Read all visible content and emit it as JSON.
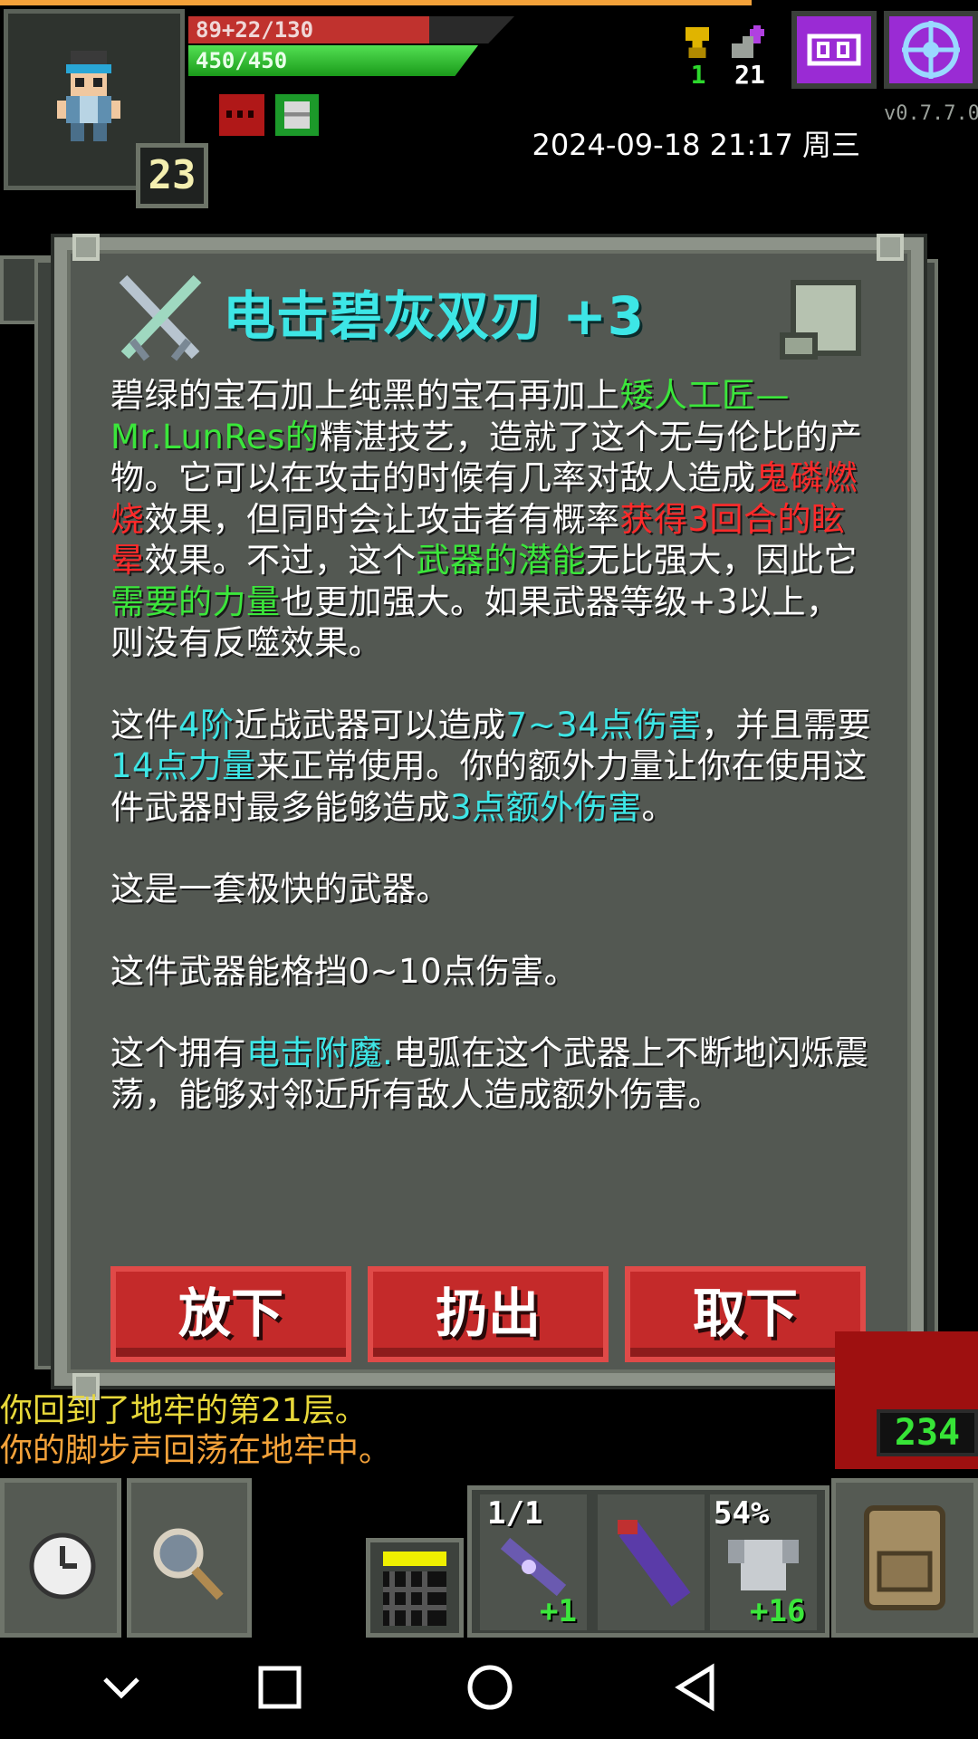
{
  "status": {
    "exp_text": "89+22/130",
    "exp_fraction": 0.74,
    "hp_text": "450/450",
    "hp_fraction": 1.0,
    "level": "23",
    "trophies": "1",
    "depth": "21",
    "version": "v0.7.7.0",
    "datetime": "2024-09-18 21:17 周三"
  },
  "dialog": {
    "title": "电击碧灰双刃 +3",
    "desc_1_a": "碧绿的宝石加上纯黑的宝石再加上",
    "desc_1_b": "矮人工匠—Mr.LunRes的",
    "desc_1_c": "精湛技艺，造就了这个无与伦比的产物。它可以在攻击的时候有几率对敌人造成",
    "desc_1_d": "鬼磷燃烧",
    "desc_1_e": "效果，但同时会让攻击者有概率",
    "desc_1_f": "获得3回合的眩晕",
    "desc_1_g": "效果。不过，这个",
    "desc_1_h": "武器的潜能",
    "desc_1_i": "无比强大，因此它",
    "desc_1_j": "需要的力量",
    "desc_1_k": "也更加强大。如果武器等级+3以上，则没有反噬效果。",
    "desc_2_a": "这件",
    "desc_2_b": "4阶",
    "desc_2_c": "近战武器可以造成",
    "desc_2_d": "7~34点伤害",
    "desc_2_e": "，并且需要",
    "desc_2_f": "14点力量",
    "desc_2_g": "来正常使用。你的额外力量让你在使用这件武器时最多能够造成",
    "desc_2_h": "3点额外伤害",
    "desc_2_i": "。",
    "desc_3": "这是一套极快的武器。",
    "desc_4": "这件武器能格挡0~10点伤害。",
    "desc_5_a": "这个拥有",
    "desc_5_b": "电击附魔.",
    "desc_5_c": "电弧在这个武器上不断地闪烁震荡，能够对邻近所有敌人造成额外伤害。",
    "buttons": {
      "put_down": "放下",
      "throw": "扔出",
      "unequip": "取下"
    }
  },
  "log": [
    "你回到了地牢的第21层。",
    "你的脚步声回荡在地牢中。"
  ],
  "enemy_hp": "234",
  "quickslots": [
    {
      "count": "1/1",
      "bonus": "+1",
      "icon": "wand-icon"
    },
    {
      "count": "",
      "bonus": "",
      "icon": "quiver-icon"
    },
    {
      "count": "54%",
      "bonus": "+16",
      "icon": "armor-icon"
    }
  ],
  "colors": {
    "green": "#3be63b",
    "red": "#ff2a2a",
    "cyan": "#3de6e6",
    "button_red": "#c42a2a",
    "panel": "#535852"
  }
}
